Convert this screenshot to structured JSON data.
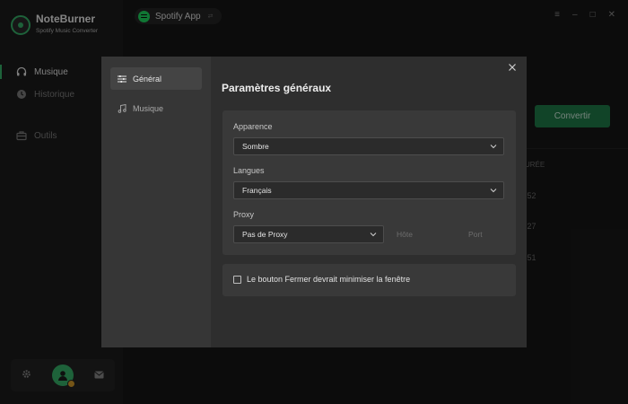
{
  "app": {
    "brand_name": "NoteBurner",
    "brand_subtitle": "Spotify Music Converter",
    "source_app": "Spotify App"
  },
  "sidebar": {
    "items": [
      {
        "label": "Musique",
        "icon": "headphones-icon",
        "active": true
      },
      {
        "label": "Historique",
        "icon": "clock-icon",
        "active": false
      },
      {
        "label": "Outils",
        "icon": "toolbox-icon",
        "active": false
      }
    ]
  },
  "window_controls": [
    "menu-icon",
    "minimize-icon",
    "maximize-icon",
    "close-icon"
  ],
  "main": {
    "convert_label": "Convertir",
    "column_fragment": "URÉE",
    "durations": [
      ":52",
      ":27",
      ":51"
    ]
  },
  "dialog": {
    "title": "Paramètres généraux",
    "tabs": [
      {
        "label": "Général",
        "icon": "sliders-icon",
        "active": true
      },
      {
        "label": "Musique",
        "icon": "music-note-icon",
        "active": false
      }
    ],
    "appearance": {
      "label": "Apparence",
      "value": "Sombre"
    },
    "language": {
      "label": "Langues",
      "value": "Français"
    },
    "proxy": {
      "label": "Proxy",
      "value": "Pas de Proxy",
      "host_placeholder": "Hôte",
      "port_placeholder": "Port"
    },
    "minimize_on_close": {
      "label": "Le bouton Fermer devrait minimiser la fenêtre",
      "checked": false
    }
  },
  "colors": {
    "accent": "#37b26a",
    "convert_button": "#1f7c4a",
    "dialog_bg": "#2e2e2e",
    "dialog_sidebar": "#363636"
  }
}
